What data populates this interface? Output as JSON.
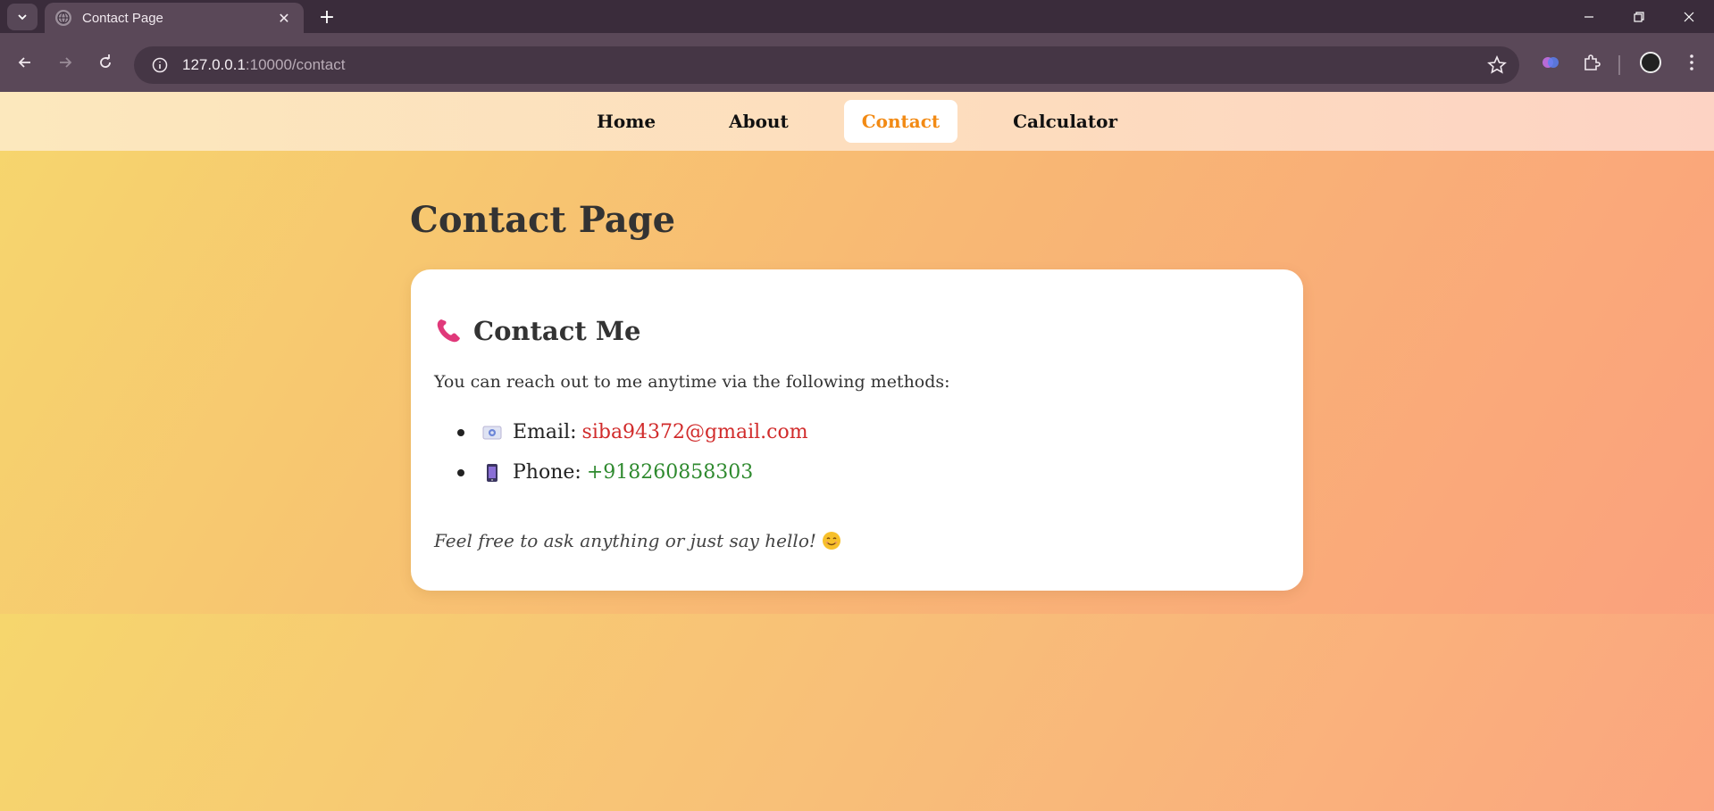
{
  "browser": {
    "tab_title": "Contact Page",
    "url_host": "127.0.0.1",
    "url_path": ":10000/contact"
  },
  "nav": {
    "items": [
      {
        "label": "Home"
      },
      {
        "label": "About"
      },
      {
        "label": "Contact",
        "active": true
      },
      {
        "label": "Calculator"
      }
    ],
    "active_color": "#f28a14"
  },
  "page": {
    "title": "Contact Page"
  },
  "card": {
    "title": "Contact Me",
    "intro": "You can reach out to me anytime via the following methods:",
    "email_label": "Email:",
    "email_value": "siba94372@gmail.com",
    "phone_label": "Phone:",
    "phone_value": "+918260858303",
    "footer": "Feel free to ask anything or just say hello!",
    "icons": [
      "phone-icon",
      "envelope-icon",
      "mobile-phone-icon",
      "smile-emoji-icon"
    ]
  },
  "colors": {
    "email_link": "#d12b2b",
    "phone_link": "#2f8a2f"
  }
}
